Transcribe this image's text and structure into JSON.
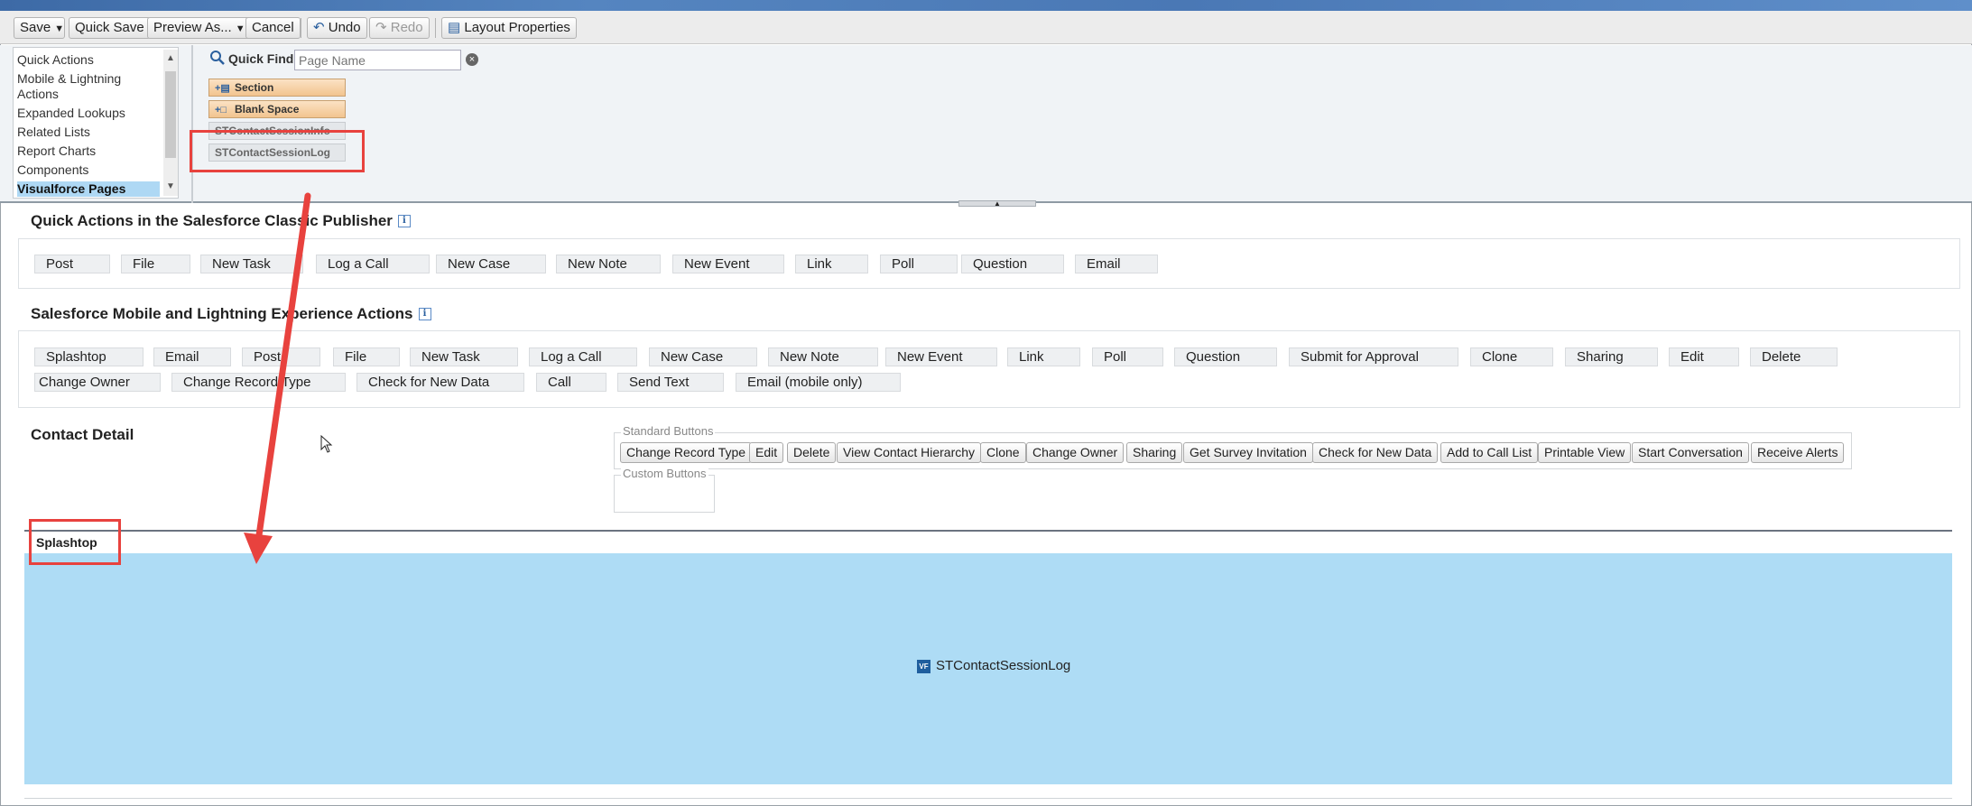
{
  "toolbar": {
    "save": "Save",
    "quick_save": "Quick Save",
    "preview_as": "Preview As...",
    "cancel": "Cancel",
    "undo": "Undo",
    "redo": "Redo",
    "layout_properties": "Layout Properties"
  },
  "palette": {
    "categories": [
      "Quick Actions",
      "Mobile & Lightning Actions",
      "Expanded Lookups",
      "Related Lists",
      "Report Charts",
      "Components",
      "Visualforce Pages"
    ],
    "selected_category": "Visualforce Pages",
    "quick_find_label": "Quick Find",
    "quick_find_placeholder": "Page Name",
    "items": [
      "Section",
      "Blank Space",
      "STContactSessionInfo",
      "STContactSessionLog"
    ]
  },
  "classic_publisher": {
    "title": "Quick Actions in the Salesforce Classic Publisher",
    "actions": [
      "Post",
      "File",
      "New Task",
      "Log a Call",
      "New Case",
      "New Note",
      "New Event",
      "Link",
      "Poll",
      "Question",
      "Email"
    ]
  },
  "mobile_actions": {
    "title": "Salesforce Mobile and Lightning Experience Actions",
    "row1": [
      "Splashtop",
      "Email",
      "Post",
      "File",
      "New Task",
      "Log a Call",
      "New Case",
      "New Note",
      "New Event",
      "Link",
      "Poll",
      "Question",
      "Submit for Approval",
      "Clone",
      "Sharing",
      "Edit",
      "Delete"
    ],
    "row2": [
      "Change Owner",
      "Change Record Type",
      "Check for New Data",
      "Call",
      "Send Text",
      "Email (mobile only)"
    ]
  },
  "contact_detail": {
    "title": "Contact Detail",
    "standard_buttons_legend": "Standard Buttons",
    "standard_buttons": [
      "Change Record Type",
      "Edit",
      "Delete",
      "View Contact Hierarchy",
      "Clone",
      "Change Owner",
      "Sharing",
      "Get Survey Invitation",
      "Check for New Data",
      "Add to Call List",
      "Printable View",
      "Start Conversation",
      "Receive Alerts"
    ],
    "custom_buttons_legend": "Custom Buttons"
  },
  "vf_section": {
    "title": "Splashtop",
    "badge": "VF",
    "page_name": "STContactSessionLog"
  },
  "colors": {
    "highlight": "#e8423e",
    "selected_bg": "#aed8f4",
    "vf_area": "#aedcf5"
  }
}
